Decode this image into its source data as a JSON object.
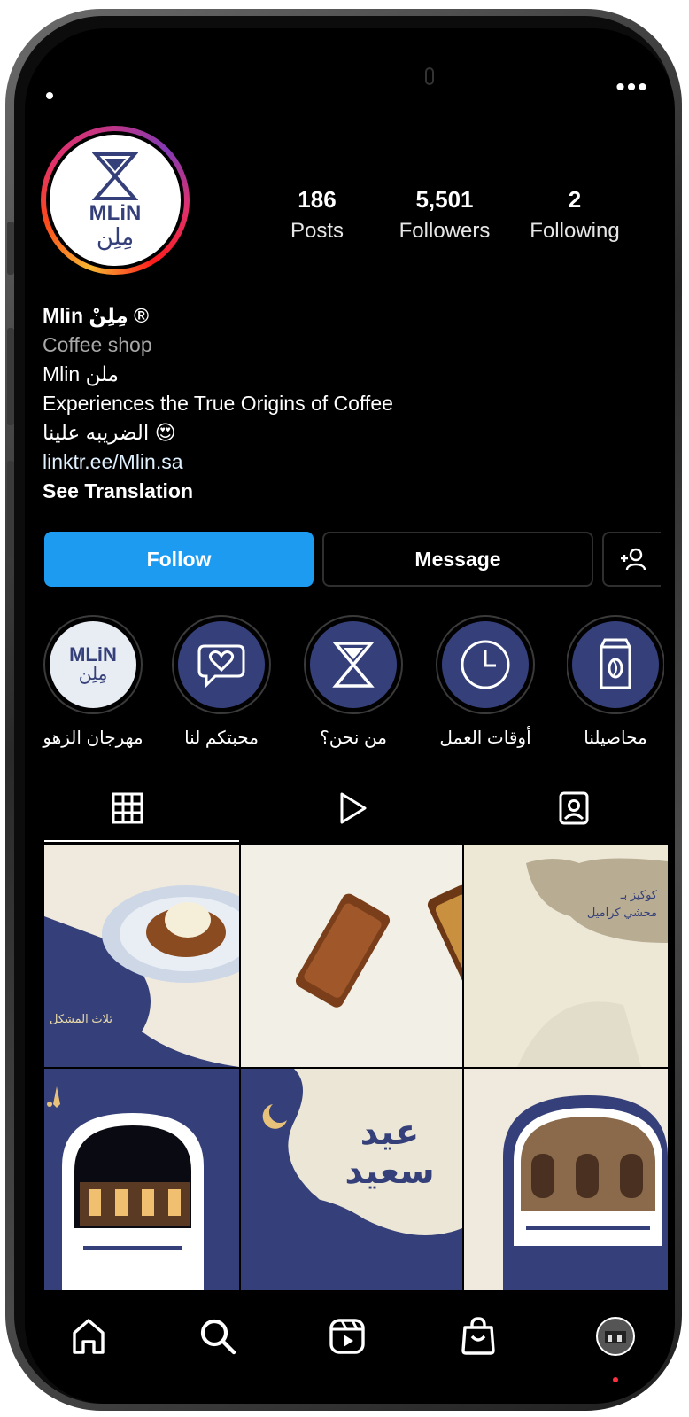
{
  "profile": {
    "username_display": "Mlin مِلِنْ",
    "verified_icon": "registered-badge-icon",
    "category": "Coffee shop",
    "bio_line_1": "Mlin ملن",
    "bio_line_2": "Experiences the True Origins of Coffee",
    "bio_line_3": "الضريبه علينا 😍",
    "link": "linktr.ee/Mlin.sa",
    "see_translation": "See Translation",
    "avatar_text_en": "MLiN",
    "avatar_text_ar": "مِلِن"
  },
  "stats": [
    {
      "value": "186",
      "label": "Posts"
    },
    {
      "value": "5,501",
      "label": "Followers"
    },
    {
      "value": "2",
      "label": "Following"
    }
  ],
  "actions": {
    "follow": "Follow",
    "message": "Message",
    "suggest_icon": "add-person-icon"
  },
  "highlights": [
    {
      "label": "مهرجان الزهو",
      "icon": "mlin-logo-image"
    },
    {
      "label": "محبتكم لنا",
      "icon": "heart-chat-icon"
    },
    {
      "label": "من نحن؟",
      "icon": "hourglass-logo-icon"
    },
    {
      "label": "أوقات العمل",
      "icon": "clock-icon"
    },
    {
      "label": "محاصيلنا",
      "icon": "coffee-bag-icon"
    }
  ],
  "tabs": [
    {
      "name": "posts-grid",
      "icon": "grid-icon",
      "active": true
    },
    {
      "name": "reels",
      "icon": "play-icon",
      "active": false
    },
    {
      "name": "tagged",
      "icon": "tagged-person-icon",
      "active": false
    }
  ],
  "posts": [
    {
      "subject": "dessert plate",
      "overlay_text": "ثلاث المشكل"
    },
    {
      "subject": "date bars",
      "overlay_text": ""
    },
    {
      "subject": "promo",
      "overlay_text": "كوكيز بـ\nمحشي كراميل"
    },
    {
      "subject": "cafe facade night",
      "overlay_text": ""
    },
    {
      "subject": "eid greeting",
      "overlay_text": "عيد سعيد"
    },
    {
      "subject": "cafe facade day",
      "overlay_text": ""
    }
  ],
  "bottom_nav": [
    {
      "name": "home",
      "icon": "home-icon"
    },
    {
      "name": "search",
      "icon": "search-icon"
    },
    {
      "name": "reels",
      "icon": "reels-icon"
    },
    {
      "name": "shop",
      "icon": "shopping-bag-icon"
    },
    {
      "name": "profile",
      "icon": "profile-avatar-icon"
    }
  ],
  "colors": {
    "follow_blue": "#1d9bf0",
    "brand_navy": "#35407a",
    "cream": "#efeadd",
    "background": "#000000"
  }
}
